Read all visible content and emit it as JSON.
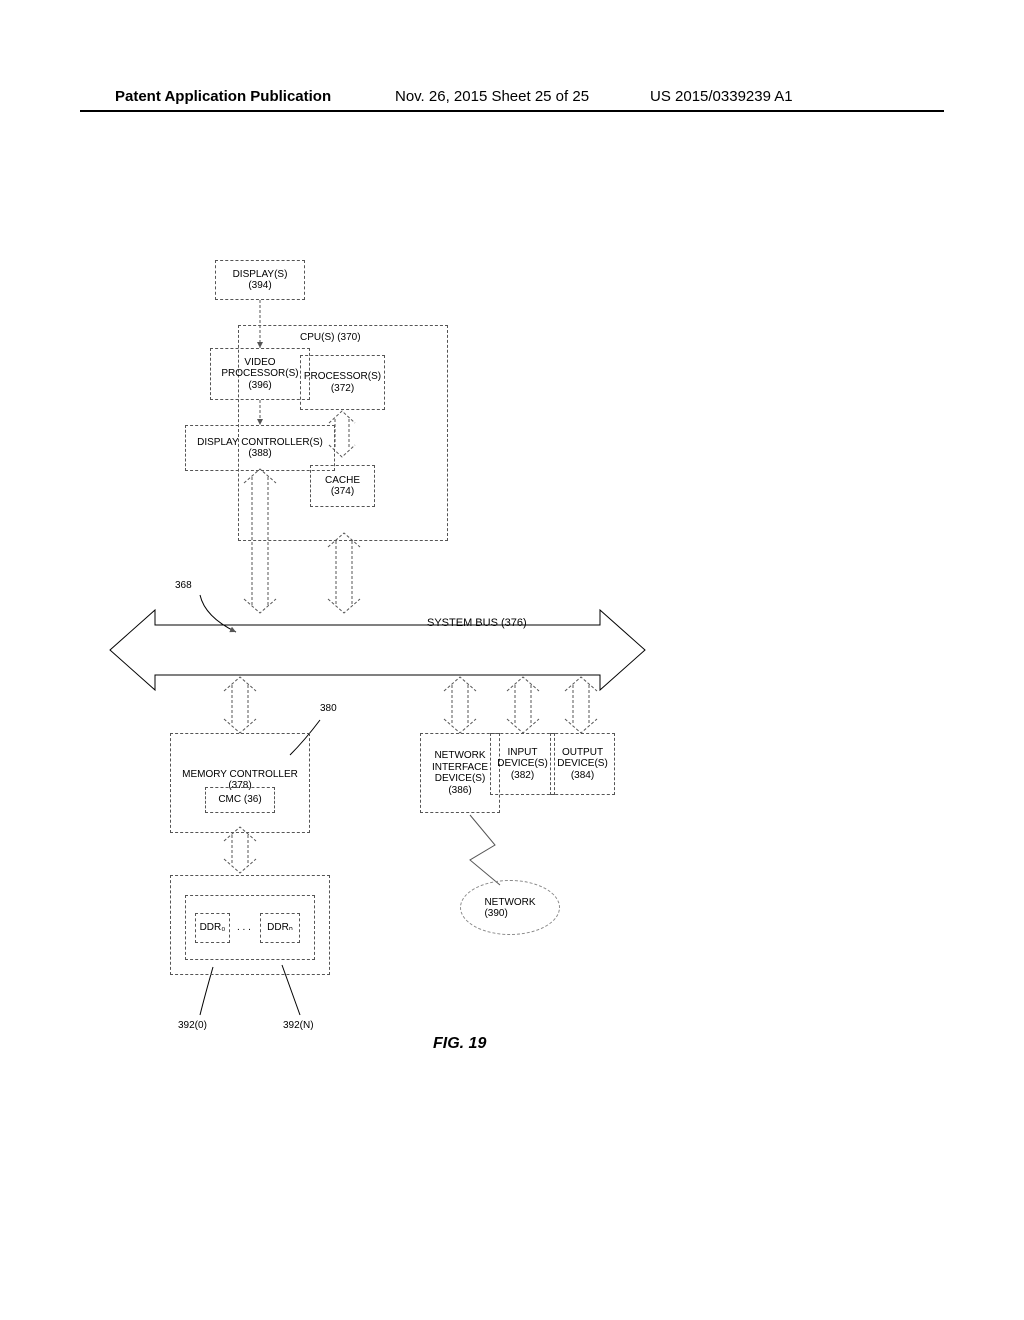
{
  "header": {
    "left": "Patent Application Publication",
    "mid": "Nov. 26, 2015  Sheet 25 of 25",
    "right": "US 2015/0339239 A1"
  },
  "figure": {
    "number": "368",
    "label": "FIG. 19"
  },
  "blocks": {
    "cpu_container": "CPU(S) (370)",
    "processor": "PROCESSOR(S)\n(372)",
    "cache": "CACHE\n(374)",
    "video_proc": "VIDEO\nPROCESSOR(S)\n(396)",
    "display": "DISPLAY(S)\n(394)",
    "display_ctrl": "DISPLAY CONTROLLER(S)\n(388)",
    "system_bus": "SYSTEM BUS (376)",
    "mem_ctrl": "MEMORY CONTROLLER\n(378)",
    "cmc": "CMC (36)",
    "ddr_left": "DDR₀",
    "ddr_right": "DDRₙ",
    "ddr_dots": ". . .",
    "net_if": "NETWORK\nINTERFACE\nDEVICE(S)\n(386)",
    "input": "INPUT\nDEVICE(S)\n(382)",
    "output": "OUTPUT\nDEVICE(S)\n(384)",
    "network": "NETWORK\n(390)"
  },
  "refs": {
    "r380": "380",
    "r392_0": "392(0)",
    "r392_n": "392(N)"
  }
}
